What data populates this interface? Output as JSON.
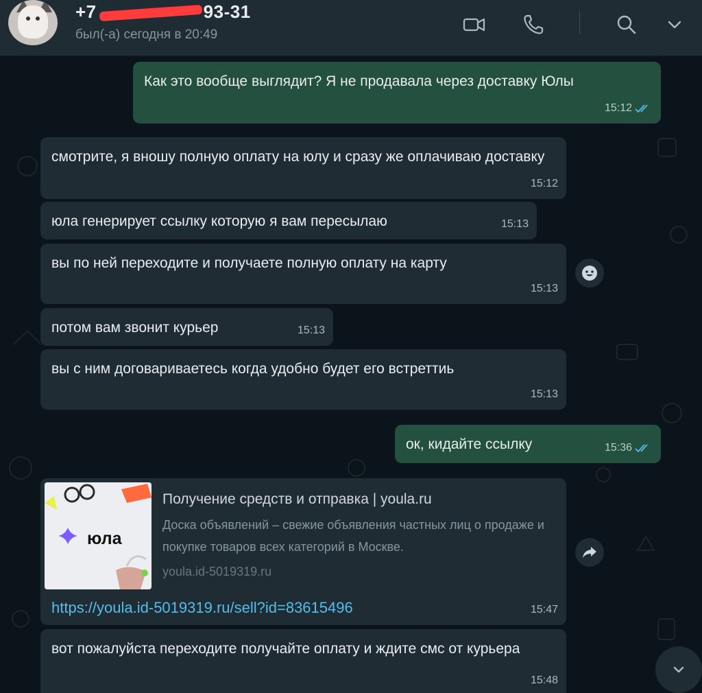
{
  "header": {
    "name_visible_suffix": "93-31",
    "name_prefix_char": "+7",
    "status": "был(-а) сегодня в 20:49"
  },
  "messages": [
    {
      "direction": "out",
      "text": "Как это вообще выглядит? Я не продавала через доставку Юлы",
      "time": "15:12",
      "read": true
    },
    {
      "direction": "in",
      "text": "смотрите, я вношу полную оплату на юлу и сразу же оплачиваю доставку",
      "time": "15:12"
    },
    {
      "direction": "in",
      "text": "юла генерирует ссылку которую я вам пересылаю",
      "time": "15:13"
    },
    {
      "direction": "in",
      "text": "вы по ней переходите и получаете полную оплату на карту",
      "time": "15:13"
    },
    {
      "direction": "in",
      "text": "потом вам звонит курьер",
      "time": "15:13"
    },
    {
      "direction": "in",
      "text": "вы с ним договариваетесь когда удобно будет его встреттиь",
      "time": "15:13"
    },
    {
      "direction": "out",
      "text": "ок, кидайте ссылку",
      "time": "15:36",
      "read": true
    },
    {
      "direction": "in",
      "type": "link",
      "preview_title": "Получение средств и отправка | youla.ru",
      "preview_desc": "Доска объявлений – свежие объявления частных лиц о продаже и покупке товаров всех категорий в Москве.",
      "preview_domain": "youla.id-5019319.ru",
      "preview_logo": "юла",
      "link": "https://youla.id-5019319.ru/sell?id=83615496",
      "time": "15:47"
    },
    {
      "direction": "in",
      "text": "вот пожалуйста переходите получайте оплату и ждите смс от курьера",
      "time": "15:48"
    }
  ],
  "colors": {
    "background": "#0b141a",
    "incoming_bubble": "#202c33",
    "outgoing_bubble": "#24503f",
    "read_ticks": "#53bdeb",
    "link": "#53bdeb"
  },
  "icons": [
    "video-call-icon",
    "voice-call-icon",
    "search-icon",
    "chevron-down-icon",
    "emoji-react-icon",
    "forward-icon",
    "scroll-down-icon"
  ]
}
